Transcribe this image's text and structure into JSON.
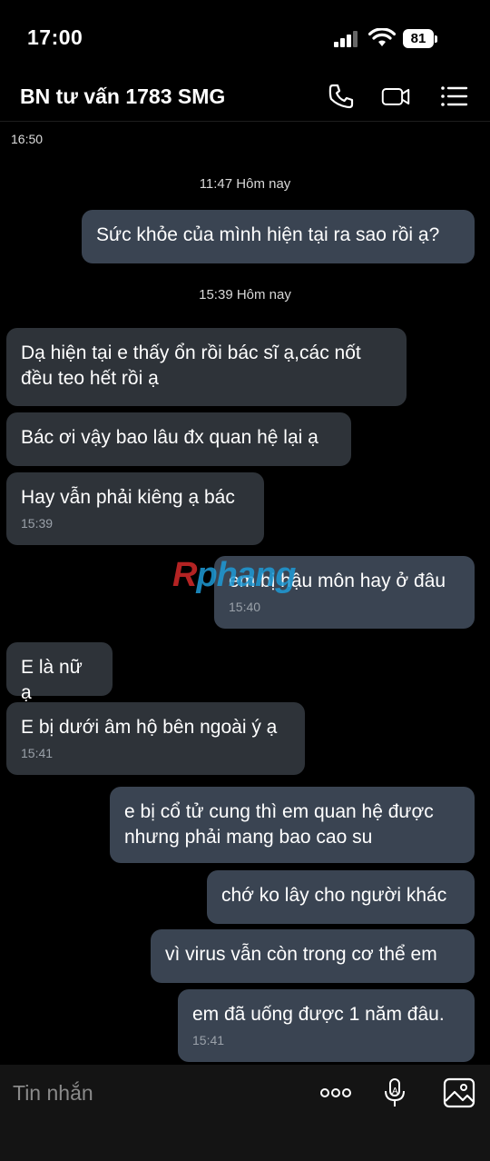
{
  "status_bar": {
    "time": "17:00",
    "battery": "81"
  },
  "header": {
    "title": "BN tư vấn 1783 SMG"
  },
  "top_time": "16:50",
  "separators": [
    "11:47 Hôm nay",
    "15:39 Hôm nay"
  ],
  "messages": [
    {
      "dir": "out",
      "text": "Sức khỏe của mình hiện tại ra sao rồi ạ?",
      "time": ""
    },
    {
      "dir": "in",
      "text": "Dạ hiện tại e thấy ổn rồi bác sĩ ạ,các nốt đều teo hết rồi ạ",
      "time": ""
    },
    {
      "dir": "in",
      "text": "Bác ơi vậy bao lâu đx quan hệ lại ạ",
      "time": ""
    },
    {
      "dir": "in",
      "text": "Hay vẫn phải kiêng ạ bác",
      "time": "15:39"
    },
    {
      "dir": "out",
      "text": "em bị hậu môn hay ở đâu",
      "time": "15:40"
    },
    {
      "dir": "in",
      "text": "E là nữ ạ",
      "time": ""
    },
    {
      "dir": "in",
      "text": "E bị dưới âm hộ bên ngoài ý ạ",
      "time": "15:41"
    },
    {
      "dir": "out",
      "text": "e bị cổ tử cung thì em quan hệ được nhưng phải mang bao cao su",
      "time": ""
    },
    {
      "dir": "out",
      "text": "chớ ko lây cho người khác",
      "time": ""
    },
    {
      "dir": "out",
      "text": "vì virus vẫn còn trong cơ thể em",
      "time": ""
    },
    {
      "dir": "out",
      "text": "em đã uống được 1 năm đâu.",
      "time": "15:41"
    }
  ],
  "watermark": {
    "first": "R",
    "rest": "phang"
  },
  "composer": {
    "placeholder": "Tin nhắn"
  },
  "icons": {
    "call": "phone-icon",
    "video": "video-camera-icon",
    "menu": "list-icon",
    "more": "more-dots-icon",
    "voice": "microphone-icon",
    "image": "image-icon"
  },
  "colors": {
    "background": "#000000",
    "incoming": "#2e3339",
    "outgoing": "#3a4452",
    "watermark_r": "#d42a2a",
    "watermark_rest": "#1e9ad6"
  }
}
